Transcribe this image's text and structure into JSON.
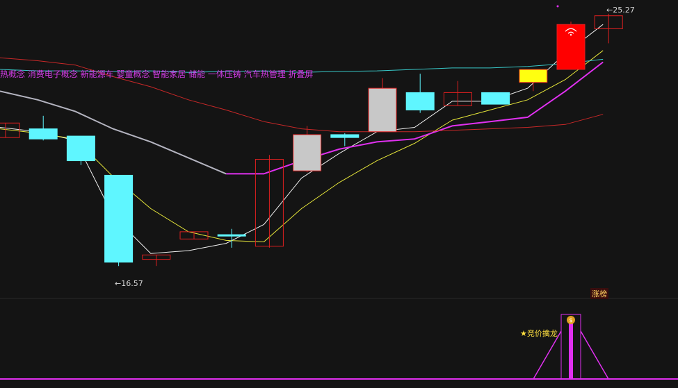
{
  "colors": {
    "background": "#141414",
    "concept_text": "#d23be6",
    "up_candle": "#e02020",
    "down_candle": "#5ff6ff",
    "neutral_candle": "#c8c8c8",
    "limit_up_fill": "#ff0000",
    "yellow_candle": "#ffff10",
    "ma_white": "#f0f0f0",
    "ma_yellow": "#e6e63a",
    "ma_magenta": "#e030f0",
    "ma_red": "#c82828",
    "ma_cyan": "#38c8c8",
    "ma_gray": "#b4b4c0",
    "label_text": "#d8d8d8",
    "badge_text": "#ffd060",
    "signal_text": "#ffe040"
  },
  "concepts": "热概念  消费电子概念  新能源车  婴童概念  智能家居  储能  一体压铸  汽车热管理  折叠屏",
  "high_price_label": "25.27",
  "low_price_label": "16.57",
  "limit_up_badge": "涨榜",
  "signal_label": "★竞价擒龙",
  "signal_icon": "money-bag-icon",
  "chart_data": {
    "type": "candlestick",
    "title": "",
    "xlabel": "",
    "ylabel": "",
    "ylim": [
      16.0,
      25.6
    ],
    "grid": false,
    "candles": [
      {
        "open": 21.5,
        "high": 21.5,
        "low": 21.0,
        "close": 21.0,
        "color": "up"
      },
      {
        "open": 21.3,
        "high": 21.75,
        "low": 20.9,
        "close": 20.95,
        "color": "down"
      },
      {
        "open": 21.05,
        "high": 21.05,
        "low": 20.05,
        "close": 20.2,
        "color": "down"
      },
      {
        "open": 19.7,
        "high": 19.7,
        "low": 16.57,
        "close": 16.7,
        "color": "down"
      },
      {
        "open": 16.8,
        "high": 16.85,
        "low": 16.57,
        "close": 16.95,
        "color": "up"
      },
      {
        "open": 17.5,
        "high": 17.75,
        "low": 17.5,
        "close": 17.75,
        "color": "up"
      },
      {
        "open": 17.65,
        "high": 17.85,
        "low": 17.2,
        "close": 17.6,
        "color": "down"
      },
      {
        "open": 17.25,
        "high": 20.4,
        "low": 17.2,
        "close": 20.25,
        "color": "up"
      },
      {
        "open": 19.85,
        "high": 21.4,
        "low": 19.8,
        "close": 21.1,
        "color": "neutral"
      },
      {
        "open": 21.1,
        "high": 21.15,
        "low": 20.7,
        "close": 21.0,
        "color": "down"
      },
      {
        "open": 21.2,
        "high": 23.05,
        "low": 21.2,
        "close": 22.7,
        "color": "neutral"
      },
      {
        "open": 22.55,
        "high": 23.2,
        "low": 21.85,
        "close": 21.95,
        "color": "down"
      },
      {
        "open": 22.1,
        "high": 22.95,
        "low": 22.1,
        "close": 22.55,
        "color": "up"
      },
      {
        "open": 22.55,
        "high": 22.55,
        "low": 22.15,
        "close": 22.15,
        "color": "down"
      },
      {
        "open": 22.9,
        "high": 23.2,
        "low": 22.6,
        "close": 23.35,
        "color": "yellow"
      },
      {
        "open": 23.35,
        "high": 25.0,
        "low": 23.35,
        "close": 24.9,
        "color": "limit_up"
      },
      {
        "open": 25.2,
        "high": 25.27,
        "low": 24.25,
        "close": 24.75,
        "color": "up"
      }
    ],
    "ma_lines": [
      {
        "color": "white",
        "values": [
          21.35,
          21.2,
          20.9,
          18.3,
          17.0,
          17.1,
          17.35,
          18.0,
          19.6,
          20.45,
          21.2,
          21.35,
          22.25,
          22.25,
          22.7,
          23.9,
          24.9
        ]
      },
      {
        "color": "yellow",
        "values": [
          21.3,
          21.15,
          20.95,
          19.65,
          18.55,
          17.75,
          17.45,
          17.4,
          18.55,
          19.45,
          20.2,
          20.8,
          21.6,
          21.95,
          22.3,
          23.0,
          24.0
        ]
      },
      {
        "color": "magenta",
        "values": [
          null,
          null,
          null,
          null,
          null,
          null,
          19.75,
          19.75,
          20.2,
          20.6,
          20.85,
          20.95,
          21.4,
          21.55,
          21.7,
          22.6,
          23.6
        ]
      },
      {
        "color": "red",
        "values": [
          23.75,
          23.65,
          23.5,
          23.1,
          22.75,
          22.3,
          21.95,
          21.55,
          21.3,
          21.2,
          21.2,
          21.2,
          21.25,
          21.3,
          21.35,
          21.45,
          21.8
        ]
      },
      {
        "color": "cyan",
        "values": [
          23.35,
          23.3,
          23.3,
          23.28,
          23.3,
          23.25,
          23.28,
          23.3,
          23.25,
          23.28,
          23.3,
          23.35,
          23.4,
          23.4,
          23.45,
          23.55,
          23.7
        ]
      },
      {
        "color": "gray",
        "values": [
          22.6,
          22.3,
          21.9,
          21.3,
          20.85,
          20.3,
          19.75,
          null,
          null,
          null,
          null,
          null,
          null,
          null,
          null,
          null,
          null
        ]
      }
    ],
    "signal_indicator": {
      "values": [
        0,
        0,
        0,
        0,
        0,
        0,
        0,
        0,
        0,
        0,
        0,
        0,
        0,
        0,
        0,
        1,
        0
      ],
      "baseline": 0
    }
  }
}
